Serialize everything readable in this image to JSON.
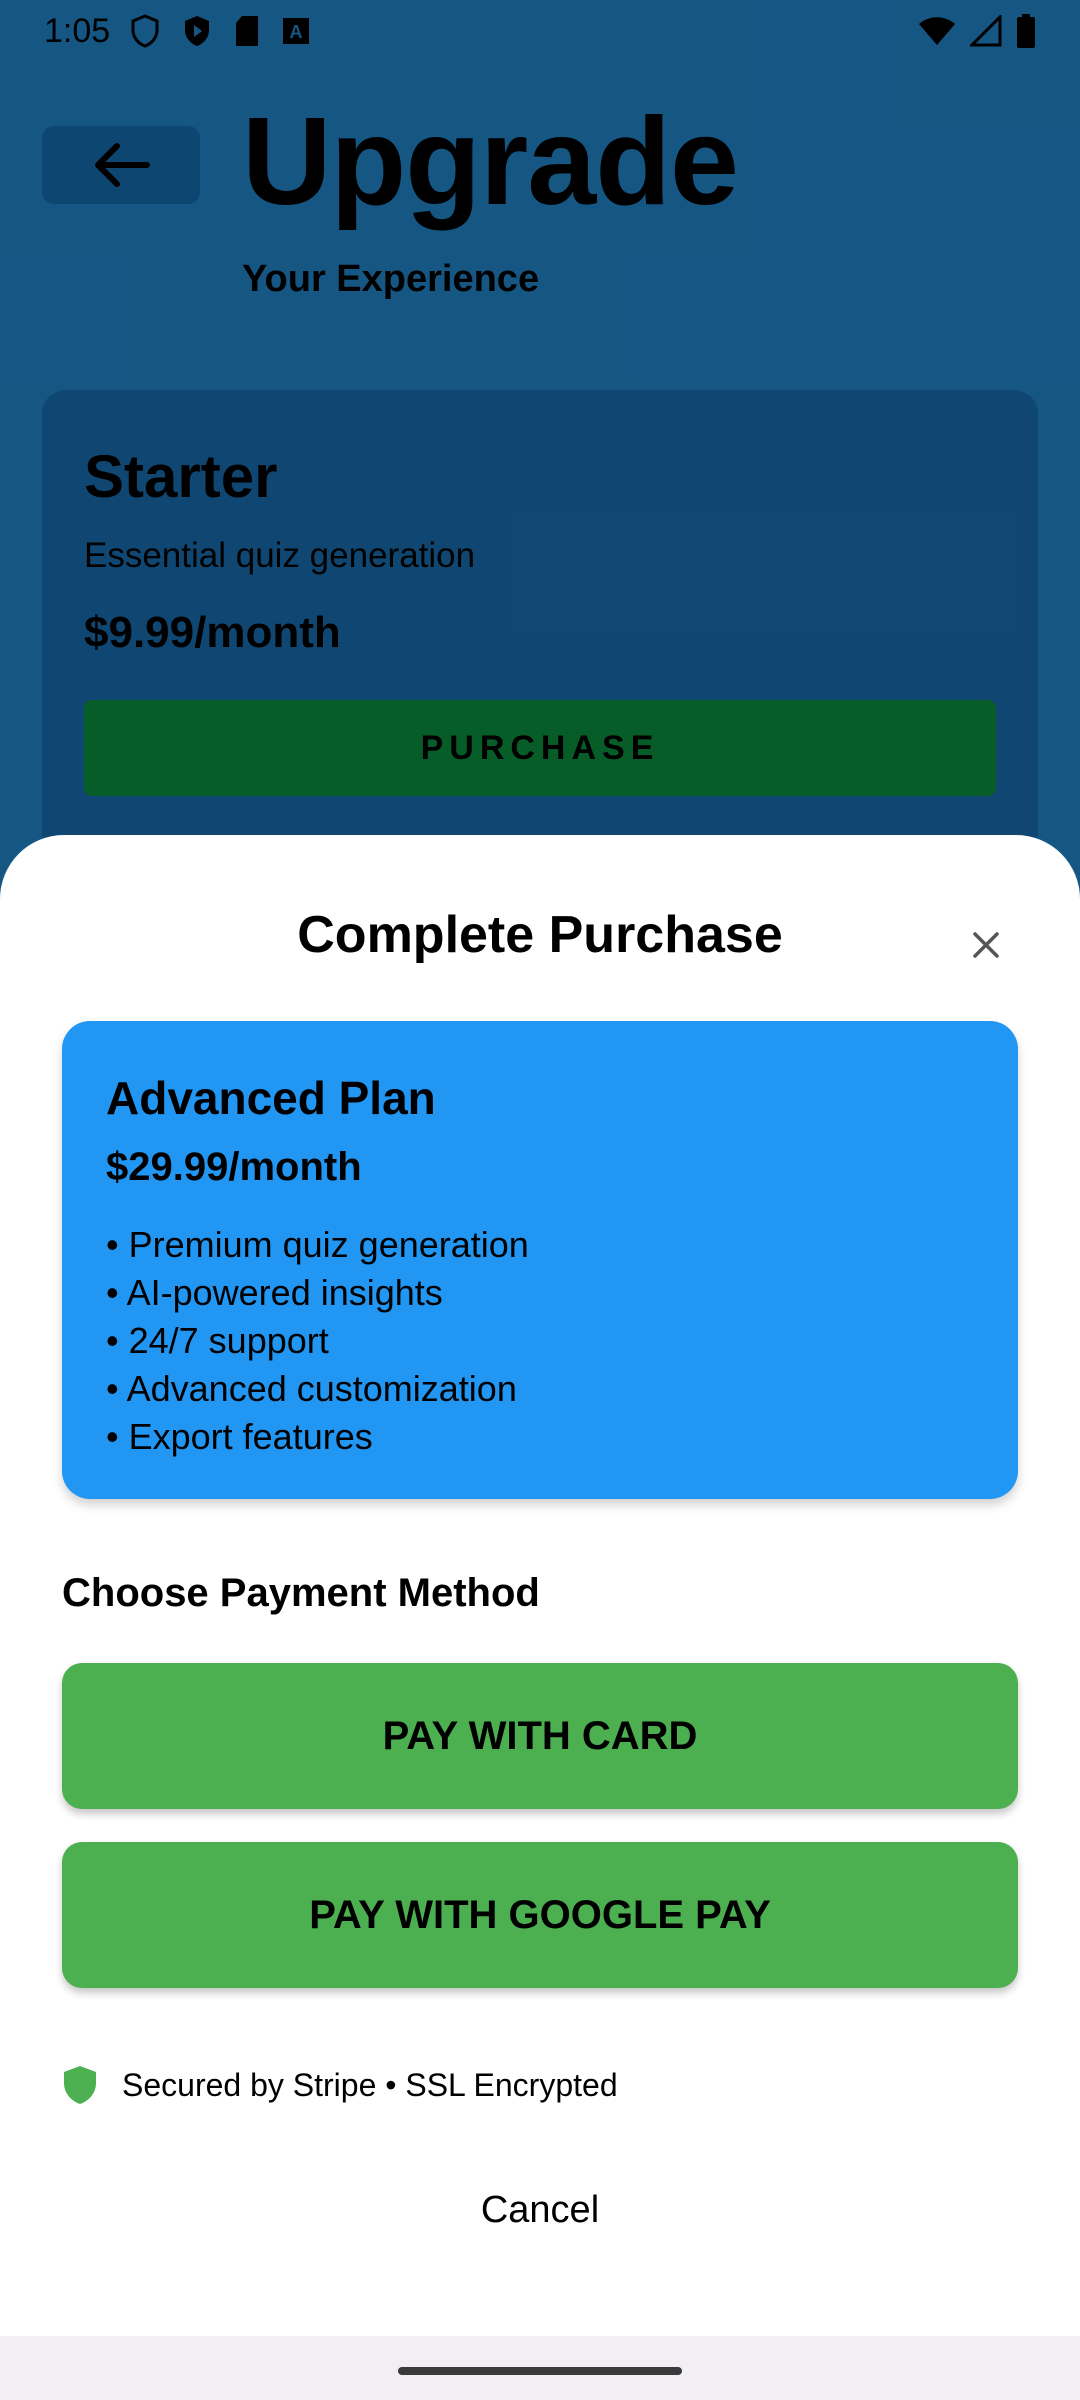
{
  "status_bar": {
    "time": "1:05",
    "left_icons": [
      "shield-icon",
      "play-store-icon",
      "sd-card-icon",
      "font-a-icon"
    ],
    "right_icons": [
      "wifi-icon",
      "signal-icon",
      "battery-icon"
    ]
  },
  "background": {
    "title": "Upgrade",
    "subtitle": "Your Experience",
    "plan": {
      "name": "Starter",
      "description": "Essential quiz generation",
      "price": "$9.99/month",
      "button_label": "PURCHASE"
    }
  },
  "sheet": {
    "title": "Complete Purchase",
    "close_icon": "close-icon",
    "selected_plan": {
      "name": "Advanced Plan",
      "price": "$29.99/month",
      "features": [
        "• Premium quiz generation",
        "• AI-powered insights",
        "• 24/7 support",
        "• Advanced customization",
        "• Export features"
      ]
    },
    "payment_label": "Choose Payment Method",
    "pay_card_label": "PAY WITH CARD",
    "pay_gpay_label": "PAY WITH GOOGLE PAY",
    "secure_text": "Secured by Stripe • SSL Encrypted",
    "cancel_label": "Cancel"
  },
  "colors": {
    "background_page": "#1f7fc2",
    "plan_card": "#1769a9",
    "purchase_button": "#0a8a3a",
    "advanced_card": "#2196f3",
    "pay_button": "#4caf50",
    "shield": "#4caf50"
  }
}
